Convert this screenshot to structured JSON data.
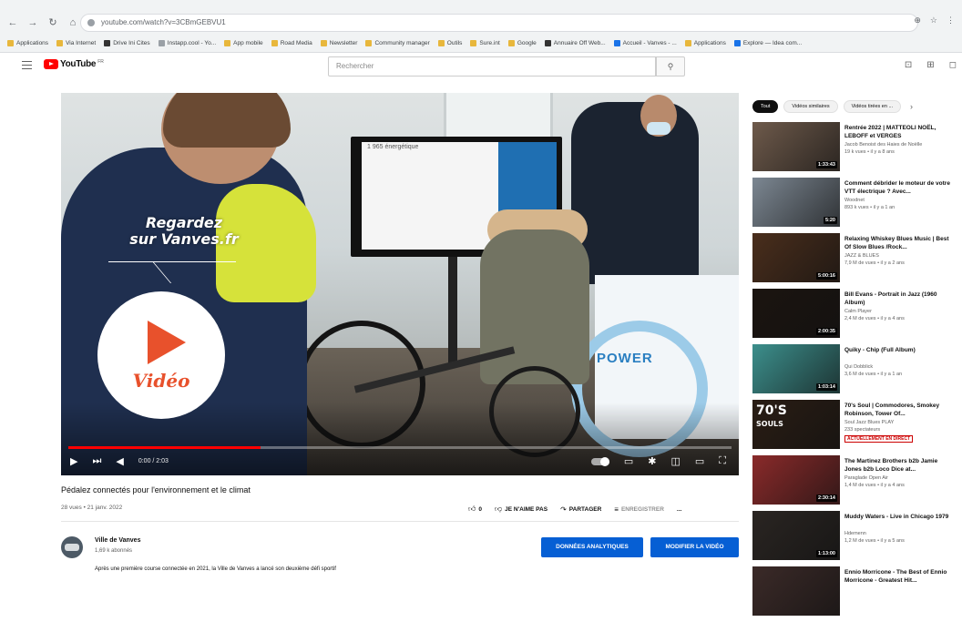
{
  "browser": {
    "url": "youtube.com/watch?v=3CBmGEBVU1",
    "bookmarks": [
      {
        "label": "Applications",
        "color": "#e8b73c"
      },
      {
        "label": "Via Internet",
        "color": "#e8b73c"
      },
      {
        "label": "Drive Ini Cites",
        "color": "#333333"
      },
      {
        "label": "Instapp.cool - Yo...",
        "color": "#9aa0a6"
      },
      {
        "label": "App mobile",
        "color": "#e8b73c"
      },
      {
        "label": "Road Media",
        "color": "#e8b73c"
      },
      {
        "label": "Newsletter",
        "color": "#e8b73c"
      },
      {
        "label": "Community manager",
        "color": "#e8b73c"
      },
      {
        "label": "Outils",
        "color": "#e8b73c"
      },
      {
        "label": "Sure.int",
        "color": "#e8b73c"
      },
      {
        "label": "Google",
        "color": "#e8b73c"
      },
      {
        "label": "Annuaire Off Web...",
        "color": "#333333"
      },
      {
        "label": "Accueil - Vanves - ...",
        "color": "#1a73e8"
      },
      {
        "label": "Applications",
        "color": "#e8b73c"
      },
      {
        "label": "Explore — Idea com...",
        "color": "#1a73e8"
      }
    ]
  },
  "header": {
    "logo_text": "YouTube",
    "logo_sup": "FR",
    "search_placeholder": "Rechercher"
  },
  "player": {
    "overlay_line1": "Regardez",
    "overlay_line2": "sur Vanves.fr",
    "overlay_video_label": "Vidéo",
    "screen_title": "1 965 énergétique",
    "banner_text": "POWER",
    "time": "0:00 / 2:03",
    "progress": 0.29
  },
  "video": {
    "title": "Pédalez connectés pour l'environnement et le climat",
    "meta": "28 vues • 21 janv. 2022",
    "likes": "0",
    "dislike_label": "JE N'AIME PAS",
    "share_label": "PARTAGER",
    "save_label": "ENREGISTRER",
    "more_label": "..."
  },
  "channel": {
    "name": "Ville de Vanves",
    "subs": "1,69 k abonnés",
    "analytics_label": "DONNÉES ANALYTIQUES",
    "edit_label": "MODIFIER LA VIDÉO",
    "description": "Après une première course connectée en 2021, la Ville de Vanves a lancé son deuxième défi sportif"
  },
  "sidebar": {
    "chips": [
      "Tout",
      "Vidéos similaires",
      "Vidéos tirées en ..."
    ],
    "recommendations": [
      {
        "title": "Rentrée 2022 | MATTEOLI NOËL, LEBOFF et VERGES",
        "channel": "Jacob Benoist des Haies de Noëlle",
        "meta": "19 k vues • il y a 8 ans",
        "duration": "1:33:43",
        "thumb": "#6e5a4b"
      },
      {
        "title": "Comment débrider le moteur de votre VTT électrique ? Avec...",
        "channel": "Woodnet",
        "meta": "893 k vues • il y a 1 an",
        "duration": "5:20",
        "thumb": "#7c8792"
      },
      {
        "title": "Relaxing Whiskey Blues Music | Best Of Slow Blues /Rock...",
        "channel": "JAZZ & BLUES",
        "meta": "7,9 M de vues • il y a 2 ans",
        "duration": "5:00:16",
        "thumb": "#4a2e1c"
      },
      {
        "title": "Bill Evans - Portrait in Jazz (1960 Album)",
        "channel": "Calm Player",
        "meta": "2,4 M de vues • il y a 4 ans",
        "duration": "2:00:35",
        "thumb": "#1b1410"
      },
      {
        "title": "Quiky - Chip (Full Album)",
        "channel": "Qui Dobblick",
        "meta": "3,6 M de vues • il y a 1 an",
        "duration": "1:03:14",
        "thumb": "#3c8f8c"
      },
      {
        "title": "70's Soul | Commodores, Smokey Robinson, Tower Of...",
        "channel": "Soul Jazz Blues PLAY",
        "meta": "233 spectateurs",
        "duration": "",
        "live": "ACTUELLEMENT EN DIRECT",
        "thumb": "#2a1d14",
        "overlay": "70'S",
        "overlay2": "SOULS"
      },
      {
        "title": "The Martinez Brothers b2b Jamie Jones b2b Loco Dice at...",
        "channel": "Paraglade Open Air",
        "meta": "1,4 M de vues • il y a 4 ans",
        "duration": "2:30:14",
        "thumb": "#8a2a2a"
      },
      {
        "title": "Muddy Waters - Live in Chicago 1979",
        "channel": "Hdemenn",
        "meta": "1,2 M de vues • il y a 5 ans",
        "duration": "1:13:00",
        "thumb": "#2a2522"
      },
      {
        "title": "Ennio Morricone - The Best of Ennio Morricone - Greatest Hit...",
        "channel": "",
        "meta": "",
        "duration": "",
        "thumb": "#3b2a28"
      }
    ]
  },
  "colors": {
    "accent_red": "#ff0000",
    "overlay_orange": "#e8512c",
    "button_blue": "#065fd4"
  }
}
